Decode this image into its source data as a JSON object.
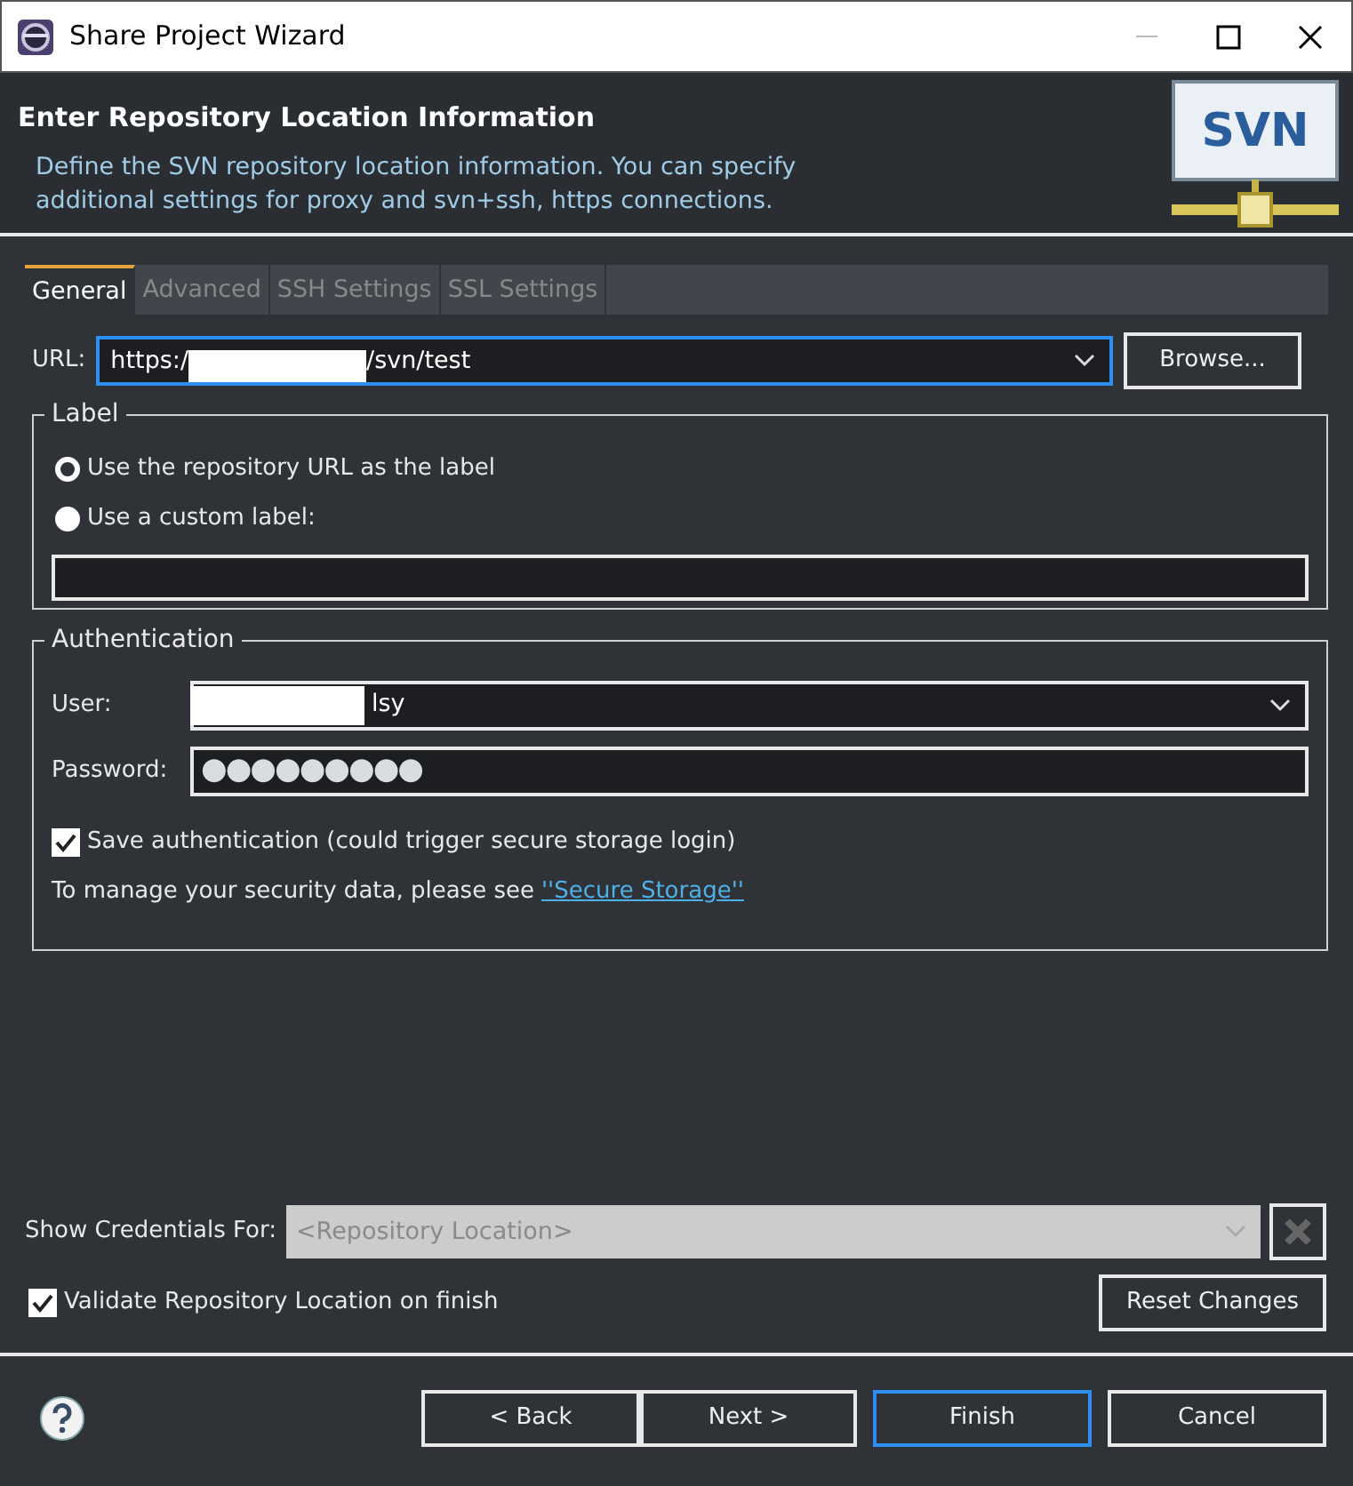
{
  "window": {
    "title": "Share Project Wizard"
  },
  "header": {
    "title": "Enter Repository Location Information",
    "description": "Define the SVN repository location information. You can specify additional settings for proxy and svn+ssh, https connections.",
    "logo_text": "SVN"
  },
  "tabs": [
    {
      "label": "General",
      "selected": true
    },
    {
      "label": "Advanced",
      "selected": false
    },
    {
      "label": "SSH Settings",
      "selected": false
    },
    {
      "label": "SSL Settings",
      "selected": false
    }
  ],
  "url": {
    "label": "URL:",
    "value_start": "https:/",
    "value_end": "/svn/test",
    "button": "Browse..."
  },
  "label_group": {
    "title": "Label",
    "options": [
      {
        "label": "Use the repository URL as the label",
        "selected": true
      },
      {
        "label": "Use a custom label:",
        "selected": false
      }
    ]
  },
  "authentication": {
    "title": "Authentication",
    "user_label": "User:",
    "user_value": "lsy",
    "password_label": "Password:",
    "password_value": "●●●●●●●●●",
    "save": {
      "label": "Save authentication (could trigger secure storage login)",
      "checked": true
    },
    "note": "To manage your security data, please see",
    "link": "''Secure Storage''"
  },
  "credentials": {
    "label": "Show Credentials For:",
    "value": "<Repository Location>",
    "disabled": true
  },
  "validate": {
    "label": "Validate Repository Location on finish",
    "checked": true
  },
  "reset_button": "Reset Changes",
  "buttons": [
    {
      "label": "< Back",
      "default": false
    },
    {
      "label": "Next >",
      "default": false
    },
    {
      "label": "Finish",
      "default": true
    },
    {
      "label": "Cancel",
      "default": false
    }
  ]
}
